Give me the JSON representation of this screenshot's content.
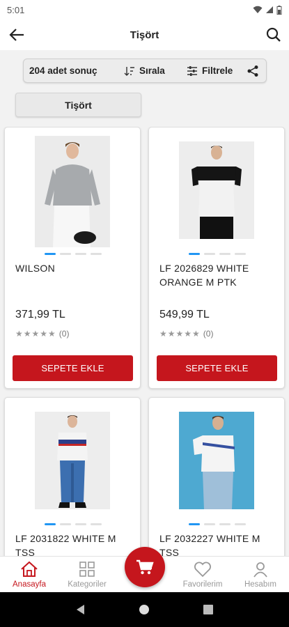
{
  "status": {
    "time": "5:01"
  },
  "header": {
    "title": "Tişört"
  },
  "toolbar": {
    "result_count": "204 adet sonuç",
    "sort_label": "Sırala",
    "filter_label": "Filtrele"
  },
  "chip": {
    "label": "Tişört"
  },
  "products": [
    {
      "name": "WILSON",
      "price": "371,99 TL",
      "rating": "(0)",
      "button": "SEPETE EKLE"
    },
    {
      "name": "LF 2026829 WHITE ORANGE M PTK",
      "price": "549,99 TL",
      "rating": "(0)",
      "button": "SEPETE EKLE"
    },
    {
      "name": "LF 2031822 WHITE M TSS",
      "price": "",
      "rating": "",
      "button": ""
    },
    {
      "name": "LF 2032227 WHITE M TSS",
      "price": "",
      "rating": "",
      "button": ""
    }
  ],
  "bottom_nav": {
    "home": "Anasayfa",
    "categories": "Kategoriler",
    "favorites": "Favorilerim",
    "account": "Hesabım"
  },
  "colors": {
    "brand": "#c5161d",
    "dot_active": "#2196f3"
  },
  "icons": [
    "back-arrow-icon",
    "search-icon",
    "sort-icon",
    "filter-icon",
    "share-icon",
    "home-icon",
    "grid-icon",
    "cart-icon",
    "heart-icon",
    "user-icon"
  ]
}
